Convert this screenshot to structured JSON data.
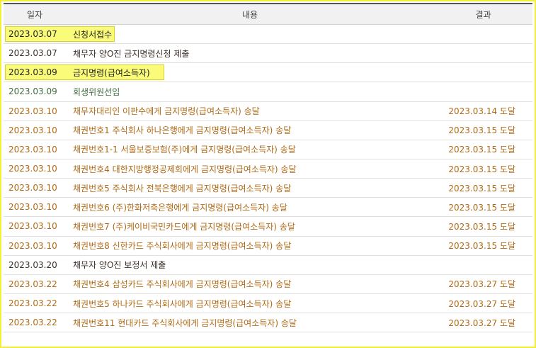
{
  "columns": {
    "date": "일자",
    "content": "내용",
    "result": "결과"
  },
  "rows": [
    {
      "date": "2023.03.07",
      "content": "신청서접수",
      "result": "",
      "style": "dark",
      "highlighted": true
    },
    {
      "date": "2023.03.07",
      "content": "채무자 양O진 금지명령신청 제출",
      "result": "",
      "style": "dark",
      "highlighted": false
    },
    {
      "date": "2023.03.09",
      "content": "금지명령(급여소득자)",
      "result": "",
      "style": "dark",
      "highlighted": true
    },
    {
      "date": "2023.03.09",
      "content": "회생위원선임",
      "result": "",
      "style": "green",
      "highlighted": false
    },
    {
      "date": "2023.03.10",
      "content": "채무자대리인 이판수에게 금지명령(급여소득자) 송달",
      "result": "2023.03.14 도달",
      "style": "orange",
      "highlighted": false
    },
    {
      "date": "2023.03.10",
      "content": "채권번호1 주식회사 하나은행에게 금지명령(급여소득자) 송달",
      "result": "2023.03.15 도달",
      "style": "orange",
      "highlighted": false
    },
    {
      "date": "2023.03.10",
      "content": "채권번호1-1 서울보증보험(주)에게 금지명령(급여소득자) 송달",
      "result": "2023.03.15 도달",
      "style": "orange",
      "highlighted": false
    },
    {
      "date": "2023.03.10",
      "content": "채권번호4 대한지방행정공제회에게 금지명령(급여소득자) 송달",
      "result": "2023.03.15 도달",
      "style": "orange",
      "highlighted": false
    },
    {
      "date": "2023.03.10",
      "content": "채권번호5 주식회사 전북은행에게 금지명령(급여소득자) 송달",
      "result": "2023.03.15 도달",
      "style": "orange",
      "highlighted": false
    },
    {
      "date": "2023.03.10",
      "content": "채권번호6 (주)한화저축은행에게 금지명령(급여소득자) 송달",
      "result": "2023.03.15 도달",
      "style": "orange",
      "highlighted": false
    },
    {
      "date": "2023.03.10",
      "content": "채권번호7 (주)케이비국민카드에게 금지명령(급여소득자) 송달",
      "result": "2023.03.15 도달",
      "style": "orange",
      "highlighted": false
    },
    {
      "date": "2023.03.10",
      "content": "채권번호8 신한카드 주식회사에게 금지명령(급여소득자) 송달",
      "result": "2023.03.15 도달",
      "style": "orange",
      "highlighted": false
    },
    {
      "date": "2023.03.20",
      "content": "채무자 양O진 보정서 제출",
      "result": "",
      "style": "dark",
      "highlighted": false
    },
    {
      "date": "2023.03.22",
      "content": "채권번호4 삼성카드 주식회사에게 금지명령(급여소득자) 송달",
      "result": "2023.03.27 도달",
      "style": "orange",
      "highlighted": false
    },
    {
      "date": "2023.03.22",
      "content": "채권번호5 하나카드 주식회사에게 금지명령(급여소득자) 송달",
      "result": "2023.03.27 도달",
      "style": "orange",
      "highlighted": false
    },
    {
      "date": "2023.03.22",
      "content": "채권번호11 현대카드 주식회사에게 금지명령(급여소득자) 송달",
      "result": "2023.03.27 도달",
      "style": "orange",
      "highlighted": false
    }
  ],
  "colors": {
    "frame_border": "#f2ee3a",
    "highlight_fill": "#fbfb7a",
    "text_dark": "#3a2f2a",
    "text_green": "#3f6b3f",
    "text_orange": "#b06a16",
    "header_bg": "#f1f1f1"
  }
}
